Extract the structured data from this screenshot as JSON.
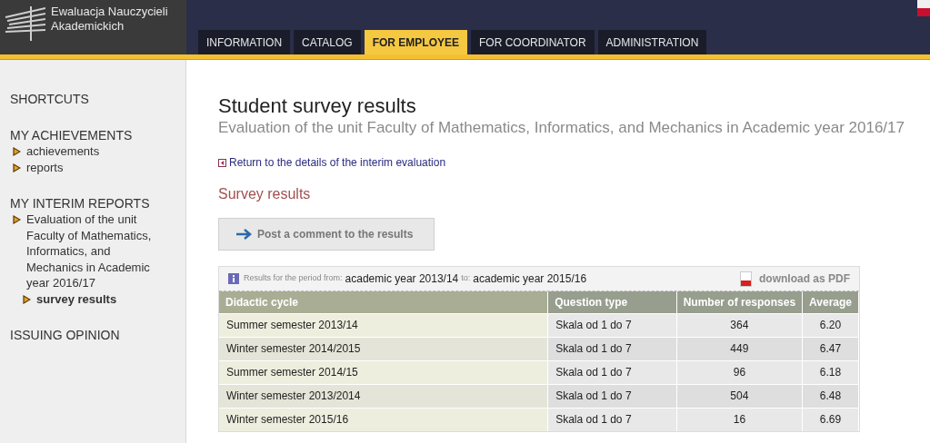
{
  "app": {
    "title": "Ewaluacja Nauczycieli Akademickich"
  },
  "tabs": [
    {
      "label": "INFORMATION",
      "selected": false
    },
    {
      "label": "CATALOG",
      "selected": false
    },
    {
      "label": "FOR EMPLOYEE",
      "selected": true
    },
    {
      "label": "FOR COORDINATOR",
      "selected": false
    },
    {
      "label": "ADMINISTRATION",
      "selected": false
    }
  ],
  "sidebar": {
    "sections": [
      {
        "title": "SHORTCUTS"
      },
      {
        "title": "MY ACHIEVEMENTS",
        "items": [
          {
            "label": "achievements",
            "selected": false
          },
          {
            "label": "reports",
            "selected": false
          }
        ]
      },
      {
        "title": "MY INTERIM REPORTS",
        "items": [
          {
            "label": "Evaluation of the unit Faculty of Mathematics, Informatics, and Mechanics in Academic year 2016/17",
            "selected": false,
            "children": [
              {
                "label": "survey results",
                "selected": true
              }
            ]
          }
        ]
      },
      {
        "title": "ISSUING OPINION"
      }
    ]
  },
  "page": {
    "title": "Student survey results",
    "subtitle": "Evaluation of the unit Faculty of Mathematics, Informatics, and Mechanics in Academic year 2016/17",
    "back_link": "Return to the details of the interim evaluation",
    "section_title": "Survey results",
    "comment_button": "Post a comment to the results"
  },
  "results": {
    "period_label_from": "Results for the period from:",
    "period_from": "academic year 2013/14",
    "period_label_to": "to:",
    "period_to": "academic year 2015/16",
    "download": "download as PDF",
    "columns": [
      "Didactic cycle",
      "Question type",
      "Number of responses",
      "Average"
    ],
    "rows": [
      [
        "Summer semester 2013/14",
        "Skala od 1 do 7",
        "364",
        "6.20"
      ],
      [
        "Winter semester 2014/2015",
        "Skala od 1 do 7",
        "449",
        "6.47"
      ],
      [
        "Summer semester 2014/15",
        "Skala od 1 do 7",
        "96",
        "6.18"
      ],
      [
        "Winter semester 2013/2014",
        "Skala od 1 do 7",
        "504",
        "6.48"
      ],
      [
        "Winter semester 2015/16",
        "Skala od 1 do 7",
        "16",
        "6.69"
      ]
    ]
  }
}
